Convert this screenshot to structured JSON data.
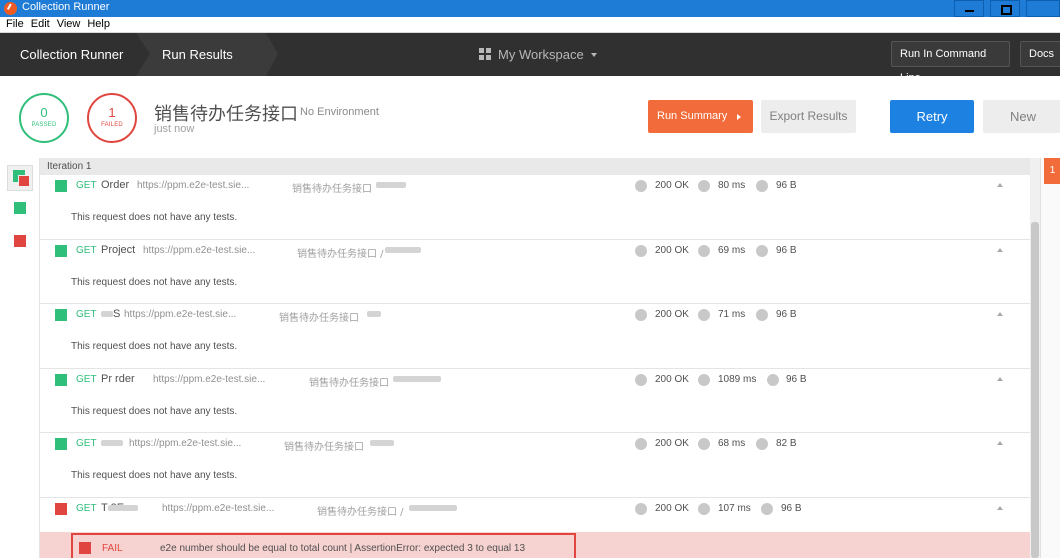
{
  "window": {
    "title": "Collection Runner"
  },
  "menu": [
    "File",
    "Edit",
    "View",
    "Help"
  ],
  "header": {
    "crumb_runner": "Collection Runner",
    "crumb_results": "Run Results",
    "workspace": "My Workspace",
    "run_command_line": "Run In Command Line",
    "docs": "Docs"
  },
  "summary": {
    "passed_count": "0",
    "passed_label": "PASSED",
    "failed_count": "1",
    "failed_label": "FAILED",
    "collection_name": "销售待办任务接口",
    "environment": "No Environment",
    "time": "just now",
    "run_summary": "Run Summary",
    "export_results": "Export Results",
    "retry": "Retry",
    "new": "New"
  },
  "iteration": {
    "label": "Iteration 1"
  },
  "requests": [
    {
      "status": "pass",
      "method": "GET",
      "name": "Order",
      "url": "https://ppm.e2e-test.sie...",
      "collection": "销售待办任务接口",
      "code": "200 OK",
      "time": "80 ms",
      "size": "96 B",
      "note": "This request does not have any tests."
    },
    {
      "status": "pass",
      "method": "GET",
      "name": "Project",
      "url": "https://ppm.e2e-test.sie...",
      "collection": "销售待办任务接口 /",
      "code": "200 OK",
      "time": "69 ms",
      "size": "96 B",
      "note": "This request does not have any tests."
    },
    {
      "status": "pass",
      "method": "GET",
      "name": "S",
      "url": "https://ppm.e2e-test.sie...",
      "collection": "销售待办任务接口",
      "code": "200 OK",
      "time": "71 ms",
      "size": "96 B",
      "note": "This request does not have any tests."
    },
    {
      "status": "pass",
      "method": "GET",
      "name": "Pr   rder",
      "url": "https://ppm.e2e-test.sie...",
      "collection": "销售待办任务接口",
      "code": "200 OK",
      "time": "1089 ms",
      "size": "96 B",
      "note": "This request does not have any tests."
    },
    {
      "status": "pass",
      "method": "GET",
      "name": "",
      "url": "https://ppm.e2e-test.sie...",
      "collection": "销售待办任务接口",
      "code": "200 OK",
      "time": "68 ms",
      "size": "82 B",
      "note": "This request does not have any tests."
    },
    {
      "status": "fail",
      "method": "GET",
      "name": "T     2E",
      "url": "https://ppm.e2e-test.sie...",
      "collection": "销售待办任务接口 /",
      "code": "200 OK",
      "time": "107 ms",
      "size": "96 B"
    }
  ],
  "failure": {
    "label": "FAIL",
    "message": "e2e number should be equal to total count | AssertionError: expected 3 to equal 13"
  },
  "right_panel": {
    "badge": "1"
  },
  "colors": {
    "pass": "#2fbf7a",
    "fail": "#e0463f",
    "accent": "#f26b3a",
    "primary": "#1d81e2"
  }
}
